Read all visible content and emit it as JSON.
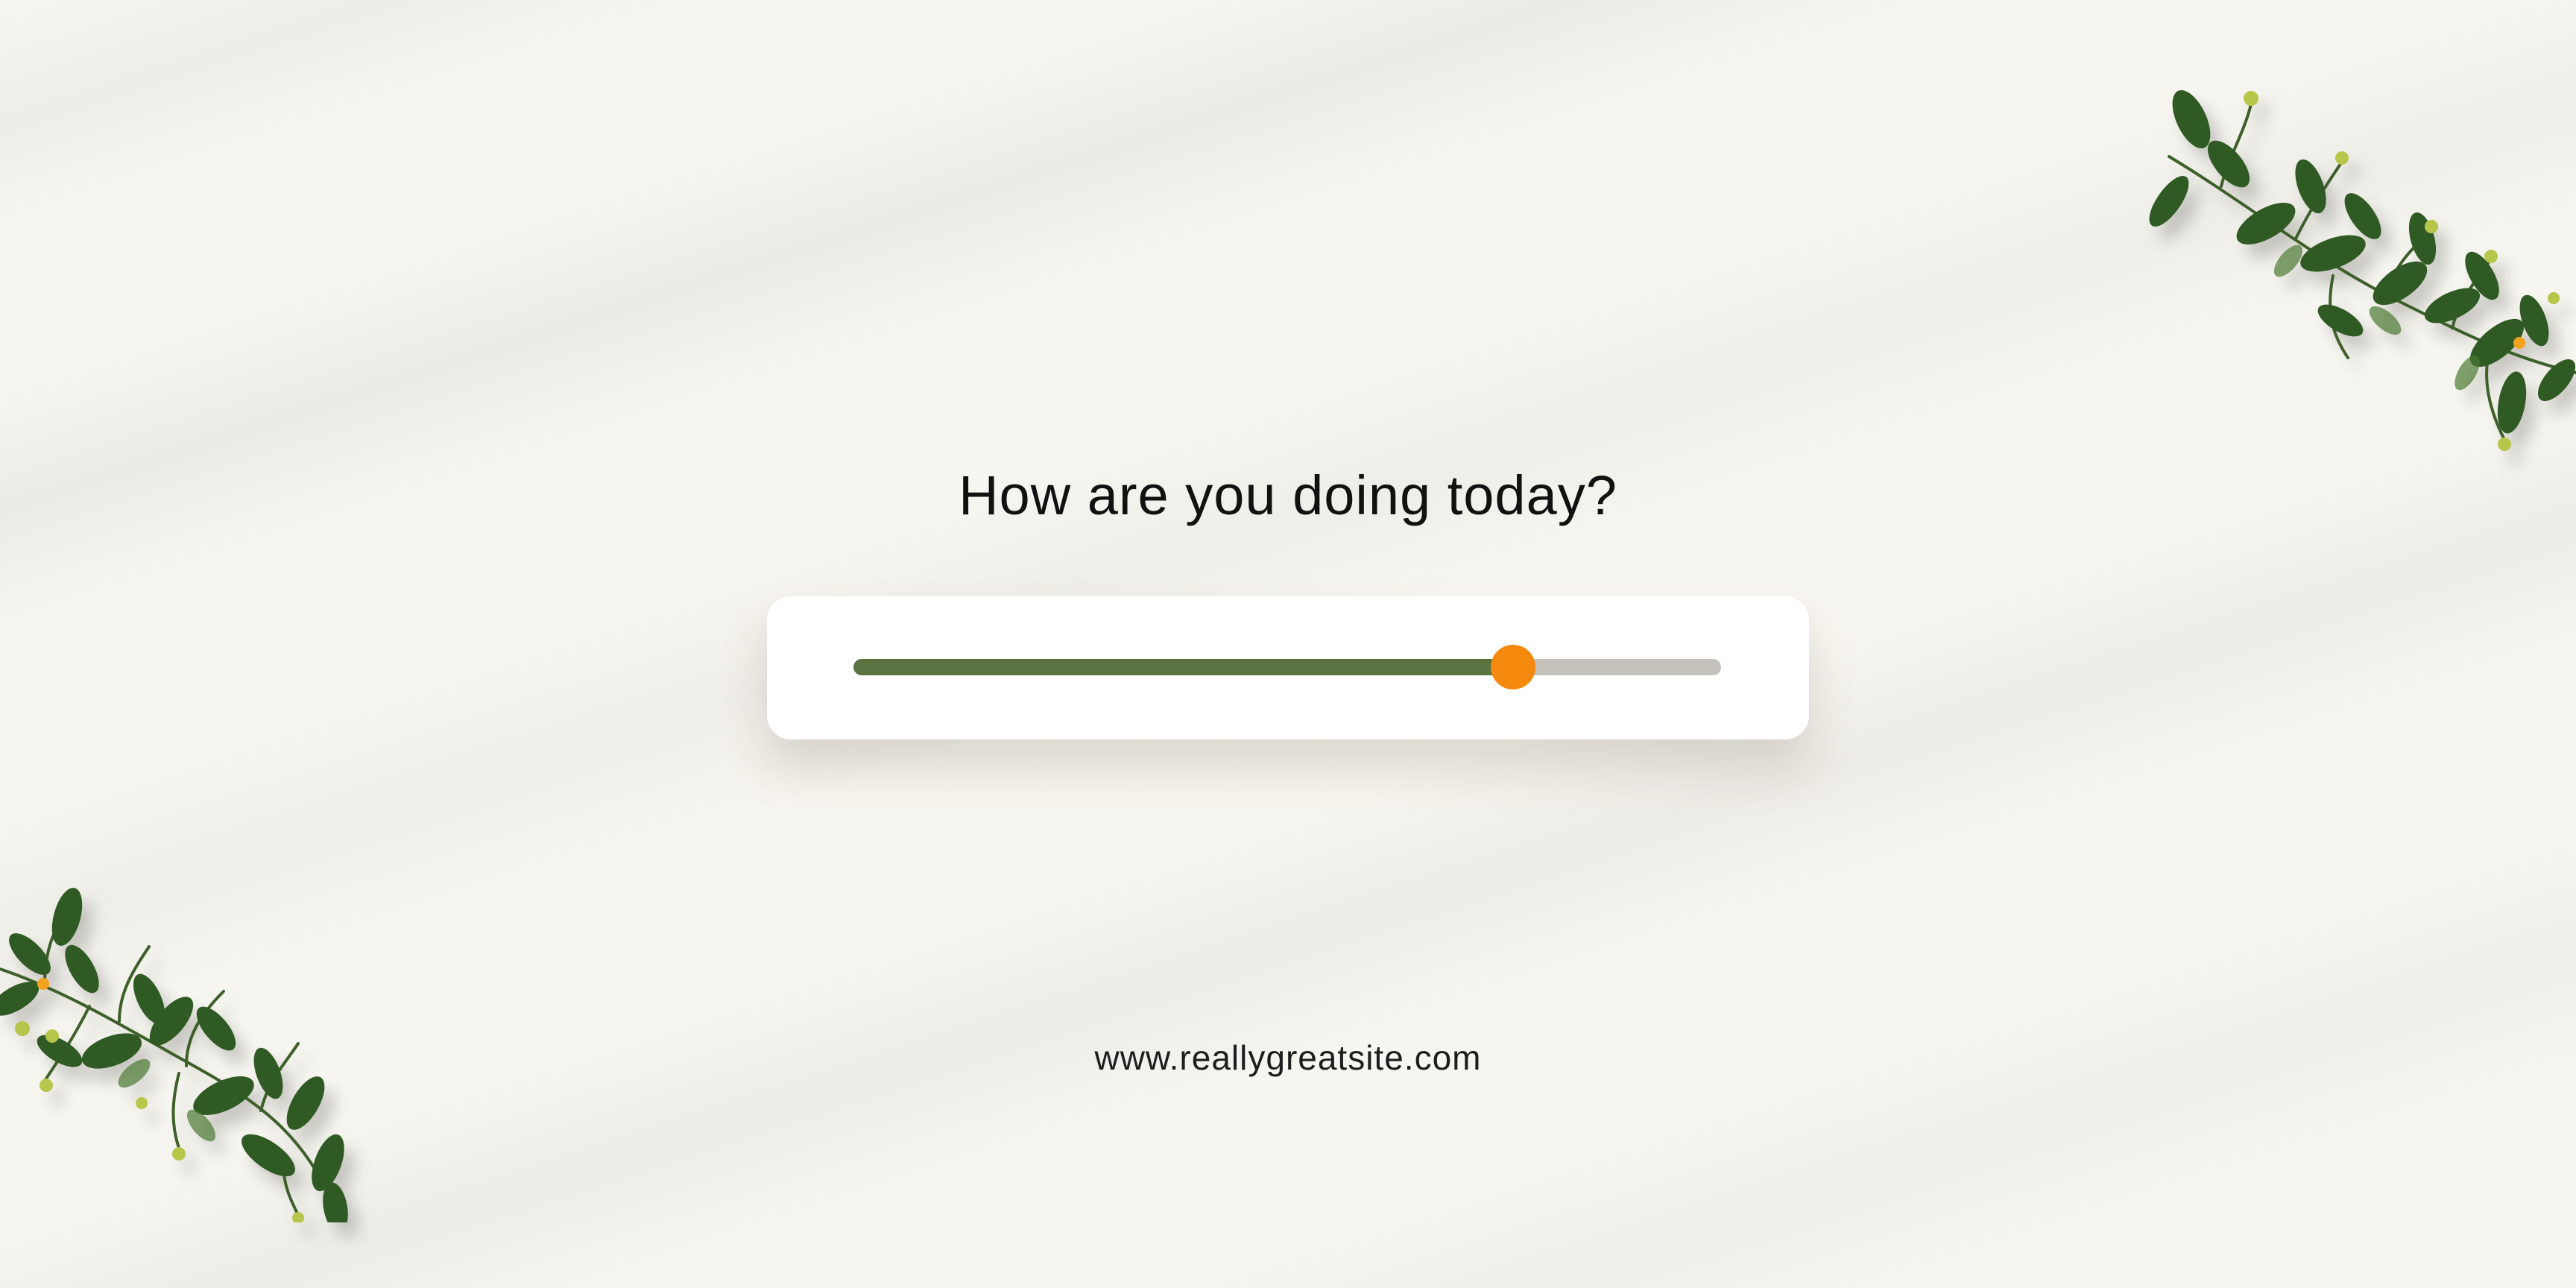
{
  "prompt": {
    "question": "How are you doing today?"
  },
  "mood_slider": {
    "value_fraction": 0.76,
    "colors": {
      "filled": "#5a7341",
      "track": "#c3c1b9",
      "thumb": "#f5890d"
    }
  },
  "footer": {
    "website": "www.reallygreatsite.com"
  },
  "decorations": {
    "top_right": "leafy-branch-icon",
    "bottom_left": "leafy-branch-icon"
  },
  "colors": {
    "background": "#f7f5ef",
    "leaf": "#2f5a23",
    "bud": "#b6c64a"
  }
}
